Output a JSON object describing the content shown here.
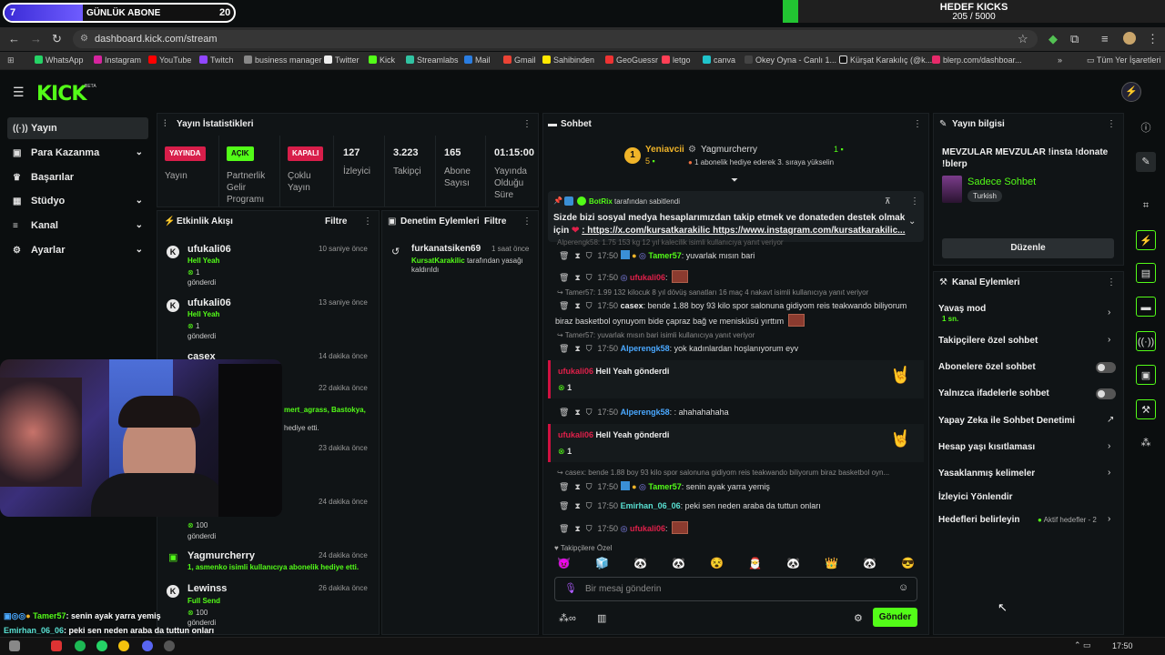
{
  "overlay": {
    "left_count": "7",
    "left_label": "GÜNLÜK ABONE",
    "left_target": "20",
    "right_title": "HEDEF KICKS",
    "right_progress": "205 / 5000",
    "right_fraction": 0.041
  },
  "browser": {
    "url": "dashboard.kick.com/stream",
    "bookmarks": [
      "WhatsApp",
      "Instagram",
      "YouTube",
      "Twitch",
      "business manager",
      "Twitter",
      "Kick",
      "Streamlabs",
      "Mail",
      "Gmail",
      "Sahibinden",
      "GeoGuessr",
      "letgo",
      "canva",
      "Okey Oyna - Canlı 1...",
      "Kürşat Karakılıç (@k...",
      "blerp.com/dashboar..."
    ],
    "bookmarks_more": "»",
    "all_bookmarks": "Tüm Yer İşaretleri"
  },
  "header": {
    "logo": "KICK",
    "beta": "BETA"
  },
  "sidebar": {
    "items": [
      {
        "label": "Yayın",
        "icon": "broadcast-icon"
      },
      {
        "label": "Para Kazanma",
        "icon": "money-icon"
      },
      {
        "label": "Başarılar",
        "icon": "trophy-icon"
      },
      {
        "label": "Stüdyo",
        "icon": "grid-icon"
      },
      {
        "label": "Kanal",
        "icon": "menu-icon"
      },
      {
        "label": "Ayarlar",
        "icon": "gear-icon"
      }
    ]
  },
  "stats": {
    "title": "Yayın İstatistikleri",
    "items": [
      {
        "badge": "YAYINDA",
        "label": "Yayın"
      },
      {
        "badge": "AÇIK",
        "label": "Partnerlik Gelir Programı"
      },
      {
        "badge": "KAPALI",
        "label": "Çoklu Yayın"
      },
      {
        "value": "127",
        "label": "İzleyici"
      },
      {
        "value": "3.223",
        "label": "Takipçi"
      },
      {
        "value": "165",
        "label": "Abone Sayısı"
      },
      {
        "value": "01:15:00",
        "label": "Yayında Olduğu Süre"
      }
    ]
  },
  "activity": {
    "title": "Etkinlik Akışı",
    "filter": "Filtre",
    "events": [
      {
        "name": "ufukali06",
        "time": "10 saniye önce",
        "line1": "Hell Yeah",
        "count": "1",
        "line2": "gönderdi"
      },
      {
        "name": "ufukali06",
        "time": "13 saniye önce",
        "line1": "Hell Yeah",
        "count": "1",
        "line2": "gönderdi"
      },
      {
        "name": "casex",
        "time": "14 dakika önce"
      },
      {
        "time": "22 dakika önce",
        "line1": "mert_agrass, Bastokya,",
        "line2": "hediye etti."
      },
      {
        "time": "23 dakika önce"
      },
      {
        "time": "24 dakika önce",
        "count": "100",
        "line2": "gönderdi"
      },
      {
        "name": "Yagmurcherry",
        "time": "24 dakika önce",
        "line1": "1, asmenko isimli kullanıcıya abonelik hediye etti."
      },
      {
        "name": "Lewinss",
        "time": "26 dakika önce",
        "line1": "Full Send",
        "count": "100",
        "line2": "gönderdi"
      }
    ]
  },
  "moderation": {
    "title": "Denetim Eylemleri",
    "filter": "Filtre",
    "item": {
      "name": "furkanatsiken69",
      "time": "1 saat önce",
      "actor": "KursatKarakilic",
      "text1": "tarafından yasağı",
      "text2": "kaldırıldı"
    }
  },
  "chat": {
    "title": "Sohbet",
    "top_gifter": {
      "rank": "1",
      "name": "Yeniavcii",
      "count": "5"
    },
    "gift_notice": {
      "name": "Yagmurcherry",
      "count": "1",
      "text": "1 abonelik hediye ederek 3. sıraya yükselin"
    },
    "pinned": {
      "by_name": "BotRix",
      "by_text": "tarafından sabitlendi",
      "message_1": "Sizde bizi sosyal medya hesaplarımızdan takip etmek ve donateden destek olmak",
      "message_2a": "için",
      "message_2b": ": https://x.com/kursatkarakilic https://www.instagram.com/kursatkarakilic..."
    },
    "cut_line": "Alperengk58: 1.75 153 kg 12 yıl kalecilik isimli kullanıcıya yanıt veriyor",
    "messages": [
      {
        "time": "17:50",
        "user": "Tamer57",
        "text": ": yuvarlak mısın bari"
      },
      {
        "time": "17:50",
        "user": "ufukali06",
        "text": ":"
      },
      {
        "reply": "Tamer57: 1.99 132 kilocuk 8 yıl dövüş sanatları 16 maç 4 nakavt isimli kullanıcıya yanıt veriyor"
      },
      {
        "time": "17:50",
        "user": "casex",
        "text": ": bende 1.88 boy 93 kilo spor salonuna gidiyom reis teakwando biliyorum",
        "text2": "biraz basketbol oynuyom bide çapraz bağ ve menisküsü yırttım"
      },
      {
        "reply": "Tamer57: yuvarlak mısın bari isimli kullanıcıya yanıt veriyor"
      },
      {
        "time": "17:50",
        "user": "Alperengk58",
        "text": ": yok kadınlardan hoşlanıyorum eyv"
      },
      {
        "gift": true,
        "user": "ufukali06",
        "text": "Hell Yeah gönderdi",
        "count": "1"
      },
      {
        "time": "17:50",
        "user": "Alperengk58",
        "text": ": ahahahahaha"
      },
      {
        "gift": true,
        "user": "ufukali06",
        "text": "Hell Yeah gönderdi",
        "count": "1"
      },
      {
        "reply": "casex: bende 1.88 boy 93 kilo spor salonuna gidiyom reis teakwando biliyorum biraz basketbol oyn..."
      },
      {
        "time": "17:50",
        "user": "Tamer57",
        "text": ": senin ayak yarra yemiş"
      },
      {
        "time": "17:50",
        "user": "Emirhan_06_06",
        "text": ": peki sen neden araba da tuttun onları"
      },
      {
        "time": "17:50",
        "user": "ufukali06",
        "text": ":"
      }
    ],
    "emote_label": "Takipçilere Özel",
    "input_placeholder": "Bir mesaj gönderin",
    "send": "Gönder"
  },
  "stream_info": {
    "title": "Yayın bilgisi",
    "stream_title": "MEVZULAR MEVZULAR !insta !donate !blerp",
    "category": "Sadece Sohbet",
    "tag": "Turkish",
    "edit": "Düzenle"
  },
  "channel_actions": {
    "title": "Kanal Eylemleri",
    "items": [
      {
        "label": "Yavaş mod",
        "sub": "1 sn.",
        "control": "chevron"
      },
      {
        "label": "Takipçilere özel sohbet",
        "control": "chevron"
      },
      {
        "label": "Abonelere özel sohbet",
        "control": "toggle"
      },
      {
        "label": "Yalnızca ifadelerle sohbet",
        "control": "toggle"
      },
      {
        "label": "Yapay Zeka ile Sohbet Denetimi",
        "control": "external"
      },
      {
        "label": "Hesap yaşı kısıtlaması",
        "control": "chevron"
      },
      {
        "label": "Yasaklanmış kelimeler",
        "control": "chevron"
      },
      {
        "label": "İzleyici Yönlendir",
        "control": "none"
      },
      {
        "label": "Hedefleri belirleyin",
        "active": "Aktif hedefler - 2",
        "control": "chevron"
      }
    ]
  },
  "overlay_chat": {
    "lines": [
      {
        "user": "Tamer57",
        "text": ": senin ayak yarra yemiş"
      },
      {
        "user": "Emirhan_06_06",
        "text": ": peki sen neden araba da tuttun onları"
      }
    ]
  },
  "taskbar": {
    "time": "17:50"
  }
}
